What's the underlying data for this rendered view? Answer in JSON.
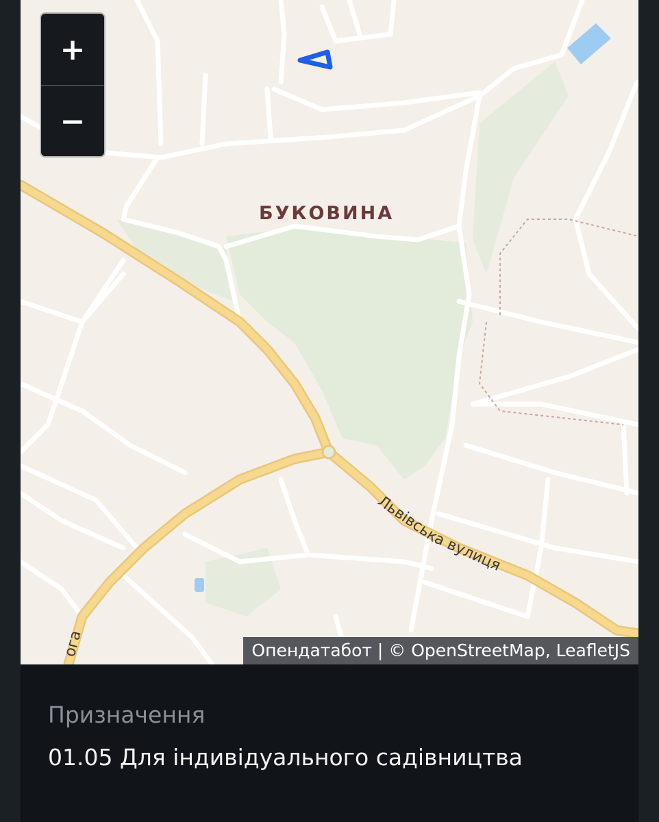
{
  "map": {
    "place_label": "БУКОВИНА",
    "street_label": "Львівська вулиця",
    "road_label_partial": "ога",
    "zoom_in_label": "+",
    "zoom_out_label": "−",
    "attribution": {
      "provider": "Опендатабот",
      "separator": " | ",
      "osm": "© OpenStreetMap",
      "comma": ", ",
      "leaflet": "LeafletJS"
    },
    "colors": {
      "land": "#f4efe8",
      "green": "#e3ebdb",
      "road_major": "#f6d88f",
      "road_major_casing": "#e9c67a",
      "road_minor": "#ffffff",
      "water": "#9ecbf2",
      "marker": "#1f5fe8"
    }
  },
  "panel": {
    "label": "Призначення",
    "value": "01.05 Для індивідуального садівництва"
  }
}
